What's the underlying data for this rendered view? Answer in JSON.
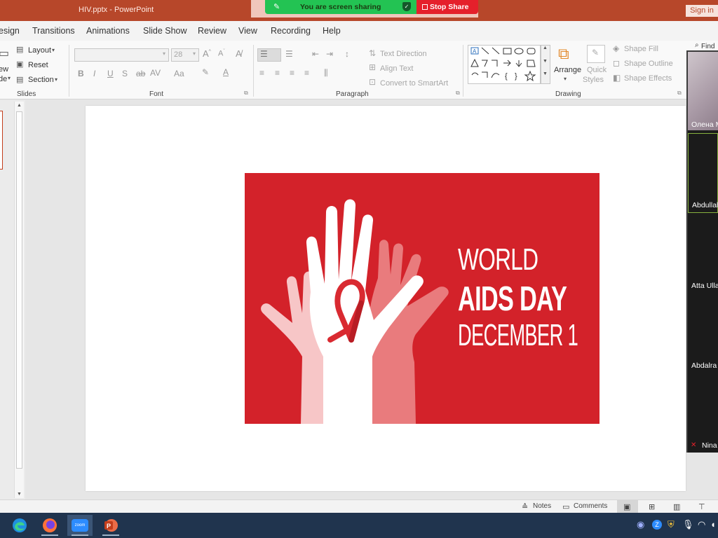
{
  "window": {
    "doc_title": "HIV.pptx  -  PowerPoint",
    "sign_in": "Sign in"
  },
  "share": {
    "banner": "You are screen sharing",
    "stop": "Stop Share"
  },
  "tabs": [
    "esign",
    "Transitions",
    "Animations",
    "Slide Show",
    "Review",
    "View",
    "Recording",
    "Help"
  ],
  "ribbon": {
    "slides": {
      "layout": "Layout",
      "reset": "Reset",
      "section": "Section",
      "new_partial_1": "ew",
      "new_partial_2": "de",
      "label": "Slides"
    },
    "font": {
      "font_size": "28",
      "label": "Font"
    },
    "paragraph": {
      "text_direction": "Text Direction",
      "align_text": "Align Text",
      "smartart": "Convert to SmartArt",
      "label": "Paragraph"
    },
    "drawing": {
      "arrange": "Arrange",
      "quick_styles_1": "Quick",
      "quick_styles_2": "Styles",
      "shape_fill": "Shape Fill",
      "shape_outline": "Shape Outline",
      "shape_effects": "Shape Effects",
      "label": "Drawing"
    },
    "find_partial": "Find"
  },
  "slide": {
    "line1": "WORLD",
    "line2": "AIDS DAY",
    "line3": "DECEMBER 1"
  },
  "zoom_participants": [
    {
      "name": "Олена М"
    },
    {
      "name": "Abdullah"
    },
    {
      "name": "Atta Ulla"
    },
    {
      "name": "Abdalra"
    },
    {
      "name": "Nina"
    }
  ],
  "statusbar": {
    "notes": "Notes",
    "comments": "Comments"
  },
  "taskbar": {
    "zoom_label": "zoom"
  },
  "colors": {
    "ppt_accent": "#b7472a",
    "poster_red": "#d3222a",
    "share_green": "#23c353",
    "stop_red": "#e5202b"
  }
}
